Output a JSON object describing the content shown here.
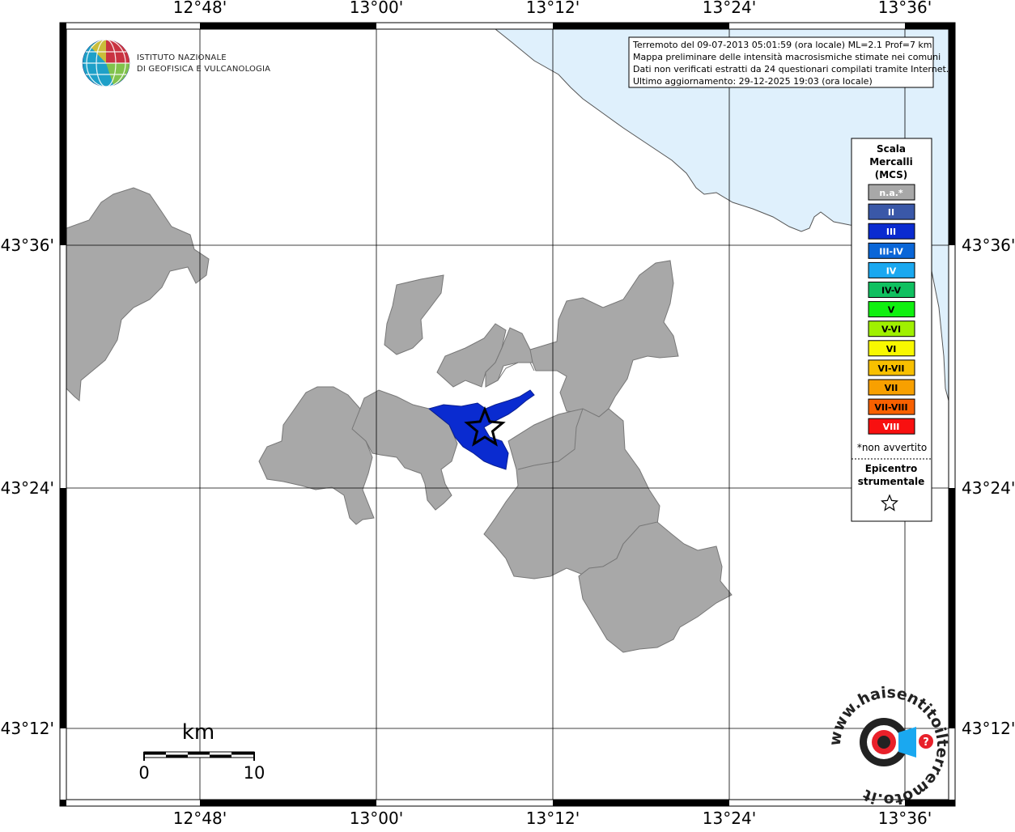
{
  "map": {
    "institute": {
      "line1": "ISTITUTO NAZIONALE",
      "line2": "DI GEOFISICA E VULCANOLOGIA"
    },
    "info_box": {
      "lines": [
        "Terremoto del 09-07-2013 05:01:59 (ora locale) ML=2.1 Prof=7 km",
        "Mappa preliminare delle intensità macrosismiche stimate nei comuni",
        "Dati non verificati estratti da 24 questionari compilati tramite Internet.",
        "Ultimo aggiornamento: 29-12-2025 19:03 (ora locale)"
      ]
    },
    "coordinates": {
      "top": [
        "12°48'",
        "13°00'",
        "13°12'",
        "13°24'",
        "13°36'"
      ],
      "bottom": [
        "12°48'",
        "13°00'",
        "13°12'",
        "13°24'",
        "13°36'"
      ],
      "left": [
        "43°36'",
        "43°24'",
        "43°12'"
      ],
      "right": [
        "43°36'",
        "43°24'",
        "43°12'"
      ]
    },
    "legend": {
      "title_lines": [
        "Scala",
        "Mercalli",
        "(MCS)"
      ],
      "items": [
        {
          "label": "n.a.*",
          "color": "#a8a8a8",
          "text_color": "#ffffff"
        },
        {
          "label": "II",
          "color": "#3a58a8",
          "text_color": "#ffffff"
        },
        {
          "label": "III",
          "color": "#0a2bd0",
          "text_color": "#ffffff"
        },
        {
          "label": "III-IV",
          "color": "#0a66d8",
          "text_color": "#ffffff"
        },
        {
          "label": "IV",
          "color": "#1aa8f0",
          "text_color": "#ffffff"
        },
        {
          "label": "IV-V",
          "color": "#10c060",
          "text_color": "#000000"
        },
        {
          "label": "V",
          "color": "#10f010",
          "text_color": "#000000"
        },
        {
          "label": "V-VI",
          "color": "#a0f000",
          "text_color": "#000000"
        },
        {
          "label": "VI",
          "color": "#f8f800",
          "text_color": "#000000"
        },
        {
          "label": "VI-VII",
          "color": "#f8c000",
          "text_color": "#000000"
        },
        {
          "label": "VII",
          "color": "#f8a000",
          "text_color": "#000000"
        },
        {
          "label": "VII-VIII",
          "color": "#f86000",
          "text_color": "#000000"
        },
        {
          "label": "VIII",
          "color": "#f81010",
          "text_color": "#ffffff"
        }
      ],
      "note": "*non avvertito",
      "epicenter_lines": [
        "Epicentro",
        "strumentale"
      ],
      "epicenter_icon": "star-outline-icon"
    },
    "scale_bar": {
      "title": "km",
      "min_label": "0",
      "max_label": "10"
    },
    "logo": {
      "ring_text": "www.haisentitoilterremoto.it",
      "question_mark": "?"
    },
    "colors": {
      "sea": "#dff0fc",
      "land": "#ffffff",
      "not_felt": "#a8a8a8",
      "intensity_III": "#0a2bd0"
    }
  }
}
